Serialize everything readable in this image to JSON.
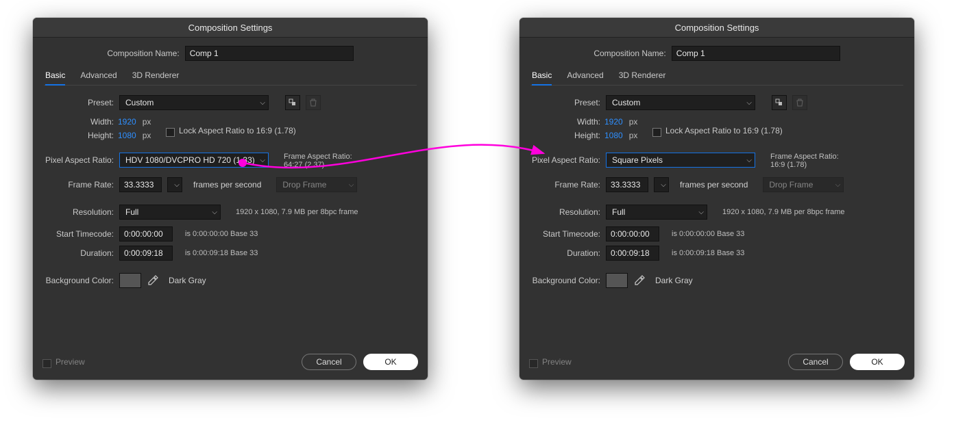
{
  "dialog_title": "Composition Settings",
  "comp_name_label": "Composition Name:",
  "comp_name_value": "Comp 1",
  "tabs": {
    "basic": "Basic",
    "advanced": "Advanced",
    "renderer": "3D Renderer"
  },
  "preset_label": "Preset:",
  "preset_value": "Custom",
  "width_label": "Width:",
  "width_value": "1920",
  "height_label": "Height:",
  "height_value": "1080",
  "px_unit": "px",
  "lock_ar_label": "Lock Aspect Ratio to 16:9 (1.78)",
  "par_label": "Pixel Aspect Ratio:",
  "par_left_value": "HDV 1080/DVCPRO HD 720 (1.33)",
  "par_right_value": "Square Pixels",
  "far_label": "Frame Aspect Ratio:",
  "far_left_value": "64:27 (2.37)",
  "far_right_value": "16:9 (1.78)",
  "framerate_label": "Frame Rate:",
  "framerate_value": "33.3333",
  "fps_unit": "frames per second",
  "dropframe_label": "Drop Frame",
  "resolution_label": "Resolution:",
  "resolution_value": "Full",
  "resolution_info": "1920 x 1080, 7.9 MB per 8bpc frame",
  "start_tc_label": "Start Timecode:",
  "start_tc_value": "0:00:00:00",
  "start_tc_info": "is 0:00:00:00  Base 33",
  "duration_label": "Duration:",
  "duration_value": "0:00:09:18",
  "duration_info": "is 0:00:09:18  Base 33",
  "bg_label": "Background Color:",
  "bg_name": "Dark Gray",
  "preview_label": "Preview",
  "cancel_label": "Cancel",
  "ok_label": "OK"
}
